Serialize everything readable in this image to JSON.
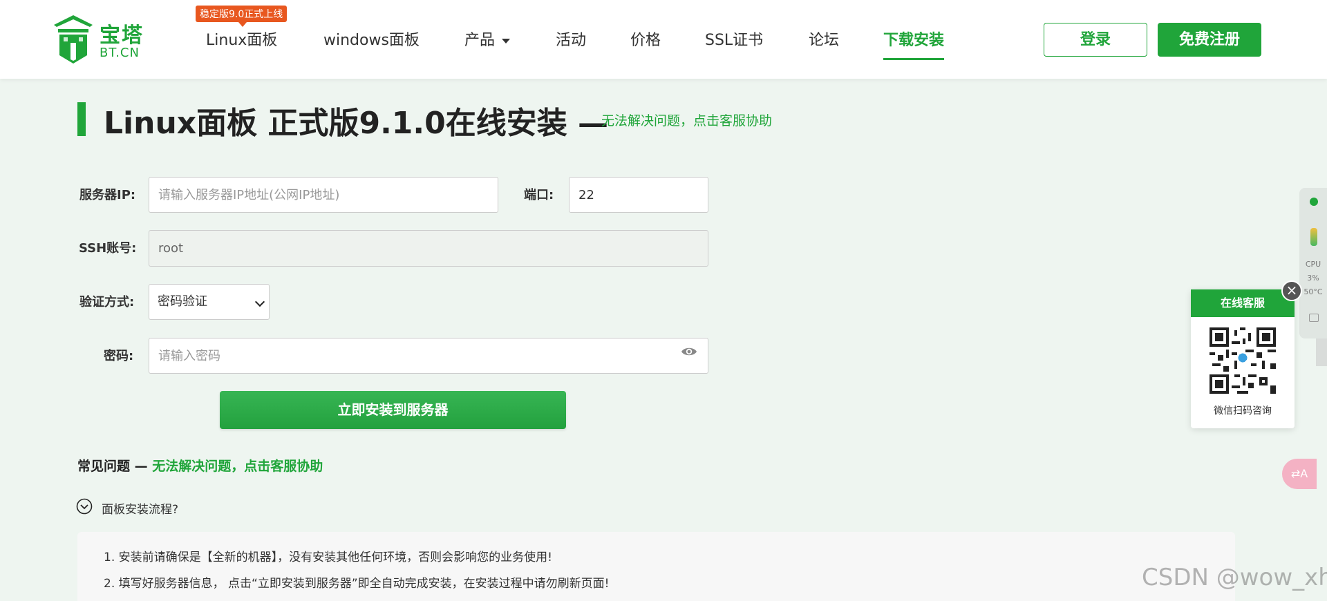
{
  "brand": {
    "name_cn": "宝塔",
    "name_en": "BT.CN",
    "color": "#20a53a"
  },
  "nav": {
    "badge": "稳定版9.0正式上线",
    "items": [
      {
        "label": "Linux面板"
      },
      {
        "label": "windows面板"
      },
      {
        "label": "产品"
      },
      {
        "label": "活动"
      },
      {
        "label": "价格"
      },
      {
        "label": "SSL证书"
      },
      {
        "label": "论坛"
      },
      {
        "label": "下载安装"
      }
    ],
    "login": "登录",
    "register": "免费注册"
  },
  "page": {
    "title": "Linux面板 正式版9.1.0在线安装 —",
    "help_link": "无法解决问题，点击客服协助"
  },
  "form": {
    "server_ip_label": "服务器IP:",
    "server_ip_placeholder": "请输入服务器IP地址(公网IP地址)",
    "port_label": "端口:",
    "port_value": "22",
    "ssh_label": "SSH账号:",
    "ssh_value": "root",
    "auth_label": "验证方式:",
    "auth_value": "密码验证",
    "password_label": "密码:",
    "password_placeholder": "请输入密码",
    "install_button": "立即安装到服务器"
  },
  "faq": {
    "title": "常见问题 —",
    "help_link": "无法解决问题，点击客服协助",
    "question": "面板安装流程?",
    "lines": [
      "1. 安装前请确保是【全新的机器】，没有安装其他任何环境，否则会影响您的业务使用!",
      "2. 填写好服务器信息， 点击“立即安装到服务器”即全自动完成安装，在安装过程中请勿刷新页面!"
    ]
  },
  "monitor": {
    "cpu_label": "CPU",
    "cpu_value": "3%",
    "temp": "50°C"
  },
  "customer_service": {
    "title": "在线客服",
    "caption": "微信扫码咨询"
  },
  "translate": {
    "label": "⇄A"
  },
  "watermark": "CSDN @wow_xh"
}
